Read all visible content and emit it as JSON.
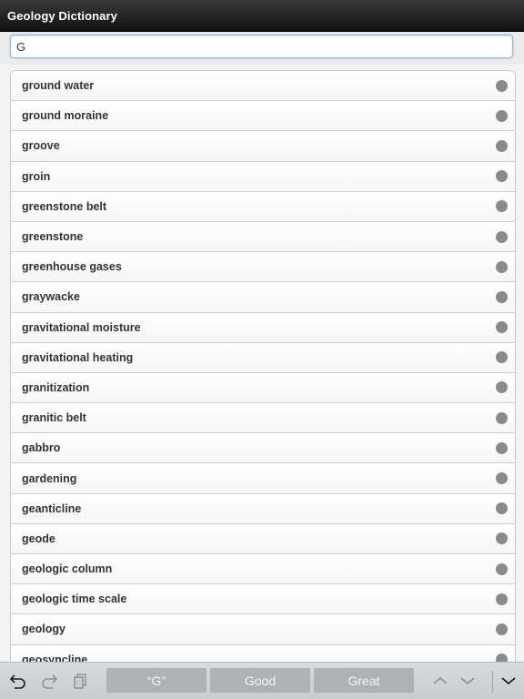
{
  "app": {
    "title": "Geology Dictionary"
  },
  "search": {
    "value": "G"
  },
  "list": {
    "items": [
      {
        "label": "ground water"
      },
      {
        "label": "ground moraine"
      },
      {
        "label": "groove"
      },
      {
        "label": "groin"
      },
      {
        "label": "greenstone belt"
      },
      {
        "label": "greenstone"
      },
      {
        "label": "greenhouse gases"
      },
      {
        "label": "graywacke"
      },
      {
        "label": "gravitational moisture"
      },
      {
        "label": "gravitational heating"
      },
      {
        "label": "granitization"
      },
      {
        "label": "granitic belt"
      },
      {
        "label": "gabbro"
      },
      {
        "label": "gardening"
      },
      {
        "label": "geanticline"
      },
      {
        "label": "geode"
      },
      {
        "label": "geologic column"
      },
      {
        "label": "geologic time scale"
      },
      {
        "label": "geology"
      },
      {
        "label": "geosyncline"
      }
    ]
  },
  "toolbar": {
    "icons": [
      "undo-icon",
      "redo-icon",
      "paste-icon",
      "chevron-up-icon",
      "chevron-down-icon",
      "dismiss-keyboard-icon"
    ],
    "suggestions": [
      "“G”",
      "Good",
      "Great"
    ]
  },
  "colors": {
    "accent": "#9bbcdc",
    "title_bar": "#1f1f1f",
    "status_dot": "#8a8a8a"
  }
}
